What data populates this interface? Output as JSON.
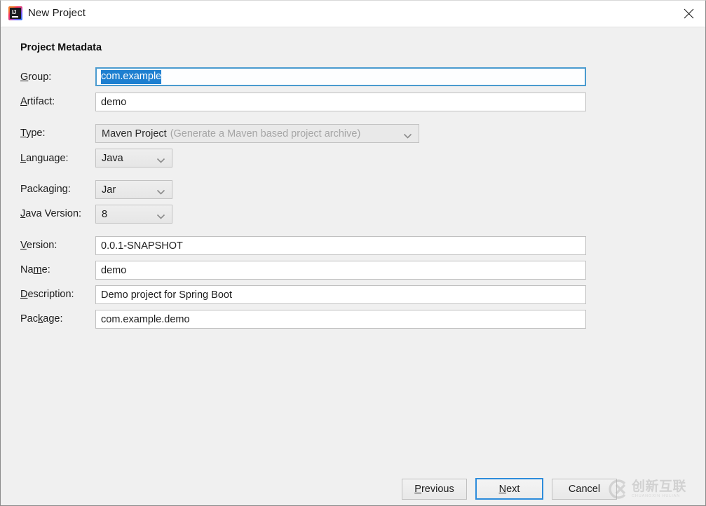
{
  "window": {
    "title": "New Project",
    "app_icon": "intellij-idea-icon",
    "close_icon": "close-icon"
  },
  "section": {
    "title": "Project Metadata"
  },
  "fields": {
    "group": {
      "label": "Group:",
      "mnemonic": "G",
      "value": "com.example",
      "selected": true,
      "focused": true
    },
    "artifact": {
      "label": "Artifact:",
      "mnemonic": "A",
      "value": "demo"
    },
    "type": {
      "label": "Type:",
      "mnemonic": "T",
      "value": "Maven Project",
      "hint": "(Generate a Maven based project archive)",
      "disabled": true,
      "icon": "chevron-down-icon"
    },
    "language": {
      "label": "Language:",
      "mnemonic": "L",
      "value": "Java",
      "icon": "chevron-down-icon"
    },
    "packaging": {
      "label": "Packaging:",
      "mnemonic": "g",
      "value": "Jar",
      "icon": "chevron-down-icon"
    },
    "java_version": {
      "label": "Java Version:",
      "mnemonic": "J",
      "value": "8",
      "icon": "chevron-down-icon"
    },
    "version": {
      "label": "Version:",
      "mnemonic": "V",
      "value": "0.0.1-SNAPSHOT"
    },
    "name": {
      "label": "Name:",
      "mnemonic": "m",
      "value": "demo"
    },
    "description": {
      "label": "Description:",
      "mnemonic": "D",
      "value": "Demo project for Spring Boot"
    },
    "package": {
      "label": "Package:",
      "mnemonic": "k",
      "value": "com.example.demo"
    }
  },
  "buttons": {
    "previous": {
      "label": "Previous",
      "mnemonic": "P"
    },
    "next": {
      "label": "Next",
      "mnemonic": "N",
      "default": true
    },
    "cancel": {
      "label": "Cancel"
    }
  },
  "watermark": {
    "cn": "创新互联",
    "en": "CHUANGXIN HULIAN",
    "icon": "cx-logo-icon"
  },
  "colors": {
    "accent": "#2d8cdb",
    "selection": "#1d7fd0",
    "focus_border": "#4a9bcf",
    "window_bg": "#f0f0f0",
    "titlebar_bg": "#ffffff",
    "field_bg": "#ffffff",
    "combo_bg": "#e9e9e9",
    "text": "#1c1c1c",
    "hint_text": "#a6a6a6"
  }
}
